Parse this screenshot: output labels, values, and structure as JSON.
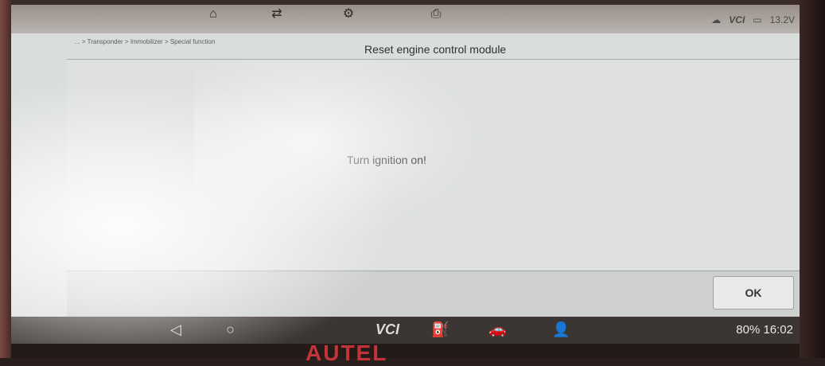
{
  "header": {
    "breadcrumb": "... > Transponder > Immobilizer > Special function",
    "title": "Reset engine control module",
    "status": {
      "vci": "VCI",
      "battery_voltage": "13.2V"
    }
  },
  "main": {
    "message": "Turn ignition on!"
  },
  "footer": {
    "ok_label": "OK"
  },
  "navbar": {
    "vci_label": "VCI",
    "system_status": "80% 16:02"
  },
  "brand": {
    "text": "AUTEL"
  }
}
